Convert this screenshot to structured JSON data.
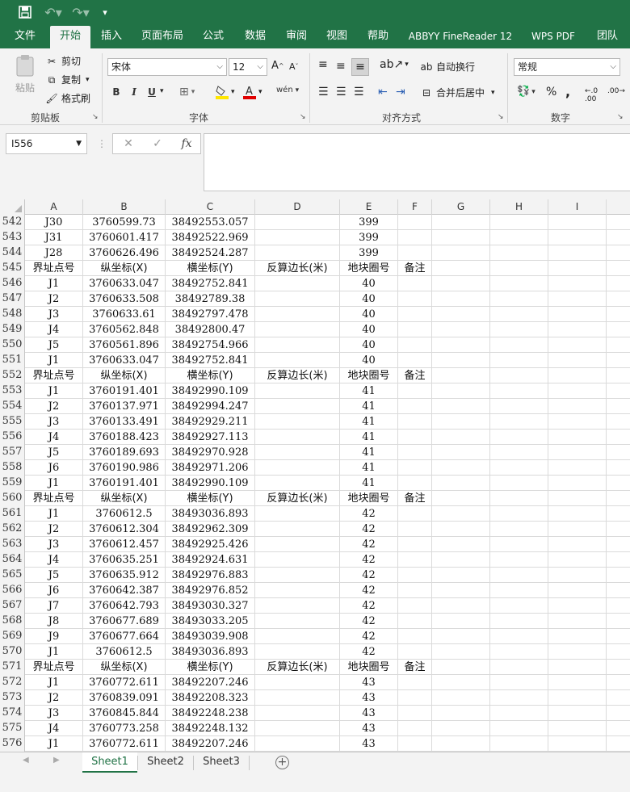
{
  "quick_access": {
    "save": "🖫",
    "undo": "↶▾",
    "redo": "↷▾",
    "customize": "▾"
  },
  "tabs": [
    "文件",
    "开始",
    "插入",
    "页面布局",
    "公式",
    "数据",
    "审阅",
    "视图",
    "帮助",
    "ABBYY FineReader 12",
    "WPS PDF",
    "团队"
  ],
  "active_tab": "开始",
  "ribbon": {
    "clipboard": {
      "paste": "粘贴",
      "cut": "剪切",
      "copy": "复制",
      "format_painter": "格式刷",
      "label": "剪贴板"
    },
    "font": {
      "name": "宋体",
      "size": "12",
      "bold": "B",
      "italic": "I",
      "underline": "U",
      "label": "字体"
    },
    "alignment": {
      "wrap_text": "自动换行",
      "merge_center": "合并后居中",
      "label": "对齐方式"
    },
    "number": {
      "format": "常规",
      "percent": "%",
      "comma": ",",
      "label": "数字"
    }
  },
  "formula_bar": {
    "name_box": "I556",
    "cancel": "✕",
    "enter": "✓",
    "fx": "fx",
    "value": ""
  },
  "columns": [
    "A",
    "B",
    "C",
    "D",
    "E",
    "F",
    "G",
    "H",
    "I"
  ],
  "rows": [
    {
      "n": "542",
      "cells": [
        "J30",
        "3760599.73",
        "38492553.057",
        "",
        "399",
        ""
      ]
    },
    {
      "n": "543",
      "cells": [
        "J31",
        "3760601.417",
        "38492522.969",
        "",
        "399",
        ""
      ]
    },
    {
      "n": "544",
      "cells": [
        "J28",
        "3760626.496",
        "38492524.287",
        "",
        "399",
        ""
      ]
    },
    {
      "n": "545",
      "hd": true,
      "cells": [
        "界址点号",
        "纵坐标(X)",
        "横坐标(Y)",
        "反算边长(米)",
        "地块圈号",
        "备注"
      ]
    },
    {
      "n": "546",
      "cells": [
        "J1",
        "3760633.047",
        "38492752.841",
        "",
        "40",
        ""
      ]
    },
    {
      "n": "547",
      "cells": [
        "J2",
        "3760633.508",
        "38492789.38",
        "",
        "40",
        ""
      ]
    },
    {
      "n": "548",
      "cells": [
        "J3",
        "3760633.61",
        "38492797.478",
        "",
        "40",
        ""
      ]
    },
    {
      "n": "549",
      "cells": [
        "J4",
        "3760562.848",
        "38492800.47",
        "",
        "40",
        ""
      ]
    },
    {
      "n": "550",
      "cells": [
        "J5",
        "3760561.896",
        "38492754.966",
        "",
        "40",
        ""
      ]
    },
    {
      "n": "551",
      "cells": [
        "J1",
        "3760633.047",
        "38492752.841",
        "",
        "40",
        ""
      ]
    },
    {
      "n": "552",
      "hd": true,
      "cells": [
        "界址点号",
        "纵坐标(X)",
        "横坐标(Y)",
        "反算边长(米)",
        "地块圈号",
        "备注"
      ]
    },
    {
      "n": "553",
      "cells": [
        "J1",
        "3760191.401",
        "38492990.109",
        "",
        "41",
        ""
      ]
    },
    {
      "n": "554",
      "cells": [
        "J2",
        "3760137.971",
        "38492994.247",
        "",
        "41",
        ""
      ]
    },
    {
      "n": "555",
      "cells": [
        "J3",
        "3760133.491",
        "38492929.211",
        "",
        "41",
        ""
      ]
    },
    {
      "n": "556",
      "cells": [
        "J4",
        "3760188.423",
        "38492927.113",
        "",
        "41",
        ""
      ]
    },
    {
      "n": "557",
      "cells": [
        "J5",
        "3760189.693",
        "38492970.928",
        "",
        "41",
        ""
      ]
    },
    {
      "n": "558",
      "cells": [
        "J6",
        "3760190.986",
        "38492971.206",
        "",
        "41",
        ""
      ]
    },
    {
      "n": "559",
      "cells": [
        "J1",
        "3760191.401",
        "38492990.109",
        "",
        "41",
        ""
      ]
    },
    {
      "n": "560",
      "hd": true,
      "cells": [
        "界址点号",
        "纵坐标(X)",
        "横坐标(Y)",
        "反算边长(米)",
        "地块圈号",
        "备注"
      ]
    },
    {
      "n": "561",
      "cells": [
        "J1",
        "3760612.5",
        "38493036.893",
        "",
        "42",
        ""
      ]
    },
    {
      "n": "562",
      "cells": [
        "J2",
        "3760612.304",
        "38492962.309",
        "",
        "42",
        ""
      ]
    },
    {
      "n": "563",
      "cells": [
        "J3",
        "3760612.457",
        "38492925.426",
        "",
        "42",
        ""
      ]
    },
    {
      "n": "564",
      "cells": [
        "J4",
        "3760635.251",
        "38492924.631",
        "",
        "42",
        ""
      ]
    },
    {
      "n": "565",
      "cells": [
        "J5",
        "3760635.912",
        "38492976.883",
        "",
        "42",
        ""
      ]
    },
    {
      "n": "566",
      "cells": [
        "J6",
        "3760642.387",
        "38492976.852",
        "",
        "42",
        ""
      ]
    },
    {
      "n": "567",
      "cells": [
        "J7",
        "3760642.793",
        "38493030.327",
        "",
        "42",
        ""
      ]
    },
    {
      "n": "568",
      "cells": [
        "J8",
        "3760677.689",
        "38493033.205",
        "",
        "42",
        ""
      ]
    },
    {
      "n": "569",
      "cells": [
        "J9",
        "3760677.664",
        "38493039.908",
        "",
        "42",
        ""
      ]
    },
    {
      "n": "570",
      "cells": [
        "J1",
        "3760612.5",
        "38493036.893",
        "",
        "42",
        ""
      ]
    },
    {
      "n": "571",
      "hd": true,
      "cells": [
        "界址点号",
        "纵坐标(X)",
        "横坐标(Y)",
        "反算边长(米)",
        "地块圈号",
        "备注"
      ]
    },
    {
      "n": "572",
      "cells": [
        "J1",
        "3760772.611",
        "38492207.246",
        "",
        "43",
        ""
      ]
    },
    {
      "n": "573",
      "cells": [
        "J2",
        "3760839.091",
        "38492208.323",
        "",
        "43",
        ""
      ]
    },
    {
      "n": "574",
      "cells": [
        "J3",
        "3760845.844",
        "38492248.238",
        "",
        "43",
        ""
      ]
    },
    {
      "n": "575",
      "cells": [
        "J4",
        "3760773.258",
        "38492248.132",
        "",
        "43",
        ""
      ]
    },
    {
      "n": "576",
      "cells": [
        "J1",
        "3760772.611",
        "38492207.246",
        "",
        "43",
        ""
      ]
    }
  ],
  "sheets": [
    "Sheet1",
    "Sheet2",
    "Sheet3"
  ],
  "active_sheet": "Sheet1",
  "colors": {
    "accent": "#217346"
  }
}
